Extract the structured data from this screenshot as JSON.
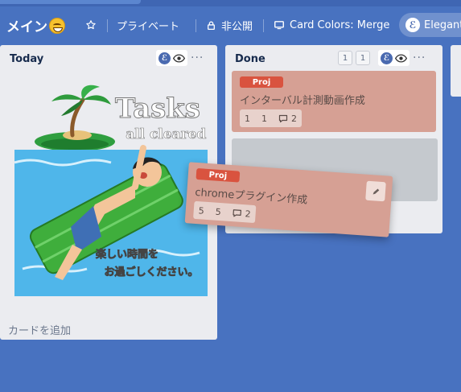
{
  "board": {
    "title": "メイン",
    "visibility_label": "プライベート",
    "privacy_label": "非公開",
    "card_colors_label": "Card Colors: Merge",
    "elegant_label": "Elegant",
    "elegant_badge": "ℰ"
  },
  "lists": [
    {
      "title": "Today",
      "add_card_label": "カードを追加",
      "illustration": {
        "heading": "Tasks",
        "subheading": "all cleared!",
        "message_line1": "楽しい時間を",
        "message_line2": "お過ごしください。"
      }
    },
    {
      "title": "Done",
      "counter_a": "1",
      "counter_b": "1",
      "cards": [
        {
          "label": "Proj",
          "title": "インターバル計測動画作成",
          "badge_a": "1",
          "badge_b": "1",
          "comments": "2"
        }
      ]
    }
  ],
  "dragged_card": {
    "label": "Proj",
    "title": "chromeプラグイン作成",
    "badge_a": "5",
    "badge_b": "5",
    "comments": "2"
  },
  "colors": {
    "board_bg": "#4872c0",
    "list_bg": "#ebecf0",
    "card_bg": "#d6a094",
    "label_red": "#d9533f"
  }
}
